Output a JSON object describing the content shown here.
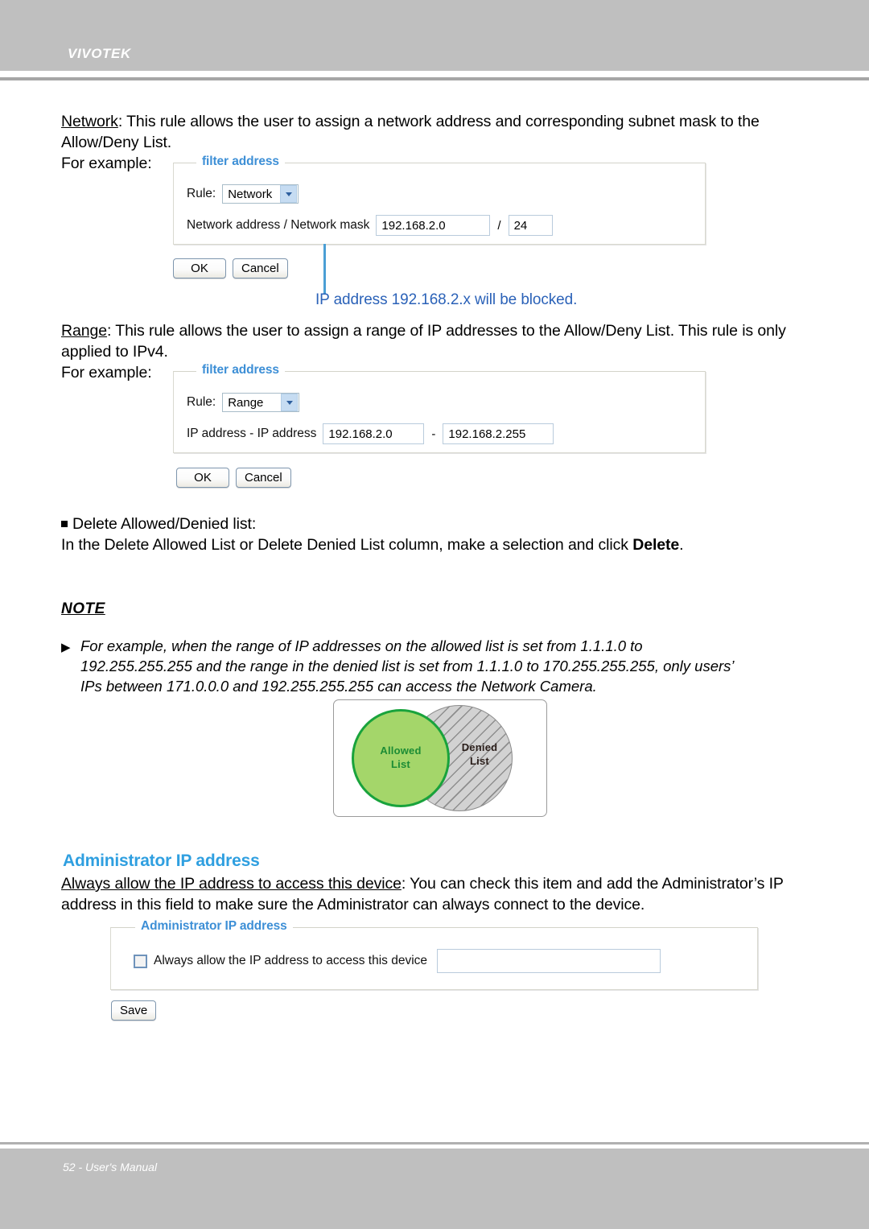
{
  "header": {
    "brand": "VIVOTEK"
  },
  "footer": {
    "page_label": "52 - User's Manual"
  },
  "content": {
    "network_rule": {
      "term": "Network",
      "description": ": This rule allows the user to assign a network address and corresponding subnet mask to the Allow/Deny List.",
      "example_label": "For example:"
    },
    "range_rule": {
      "term": "Range",
      "description": ": This rule allows the user to assign a range of IP addresses to the Allow/Deny List. This rule is only applied to IPv4.",
      "example_label": "For example:"
    },
    "delete_section": {
      "bullet_title": "Delete Allowed/Denied list:",
      "text_before": "In the Delete Allowed List or Delete Denied List column, make a selection and click ",
      "bold_word": "Delete",
      "text_after": "."
    },
    "note": {
      "title": "NOTE",
      "arrow": "▶",
      "line1": "For example, when the range of IP addresses on the allowed list is set from 1.1.1.0 to",
      "line2": "192.255.255.255 and the range in the denied list is set from 1.1.1.0 to 170.255.255.255, only users’",
      "line3": "IPs between 171.0.0.0 and 192.255.255.255 can access the Network Camera."
    },
    "admin_section": {
      "heading": "Administrator IP address",
      "term": "Always allow the IP address to access this device",
      "description": ": You can check this item and add the Administrator’s IP address in this field to make sure the Administrator can always connect to the device."
    }
  },
  "network_panel": {
    "legend": "filter address",
    "rule_label": "Rule:",
    "rule_value": "Network",
    "address_label": "Network address / Network mask",
    "address_value": "192.168.2.0",
    "separator": "/",
    "mask_value": "24",
    "ok_label": "OK",
    "cancel_label": "Cancel",
    "callout": "IP address 192.168.2.x will be blocked.",
    "callout_color": "#2b62b8"
  },
  "range_panel": {
    "legend": "filter address",
    "rule_label": "Rule:",
    "rule_value": "Range",
    "address_label": "IP address - IP address",
    "start_value": "192.168.2.0",
    "separator": "-",
    "end_value": "192.168.2.255",
    "ok_label": "OK",
    "cancel_label": "Cancel"
  },
  "venn": {
    "allowed_line1": "Allowed",
    "allowed_line2": "List",
    "denied_line1": "Denied",
    "denied_line2": "List",
    "allowed_color": "#a4d66a",
    "allowed_border": "#19a33c",
    "denied_color": "#d2d2d2"
  },
  "admin_panel": {
    "legend": "Administrator IP address",
    "checkbox_label": "Always allow the IP address to access this device",
    "ip_value": "",
    "ip_placeholder": "",
    "save_label": "Save",
    "checked": false
  }
}
